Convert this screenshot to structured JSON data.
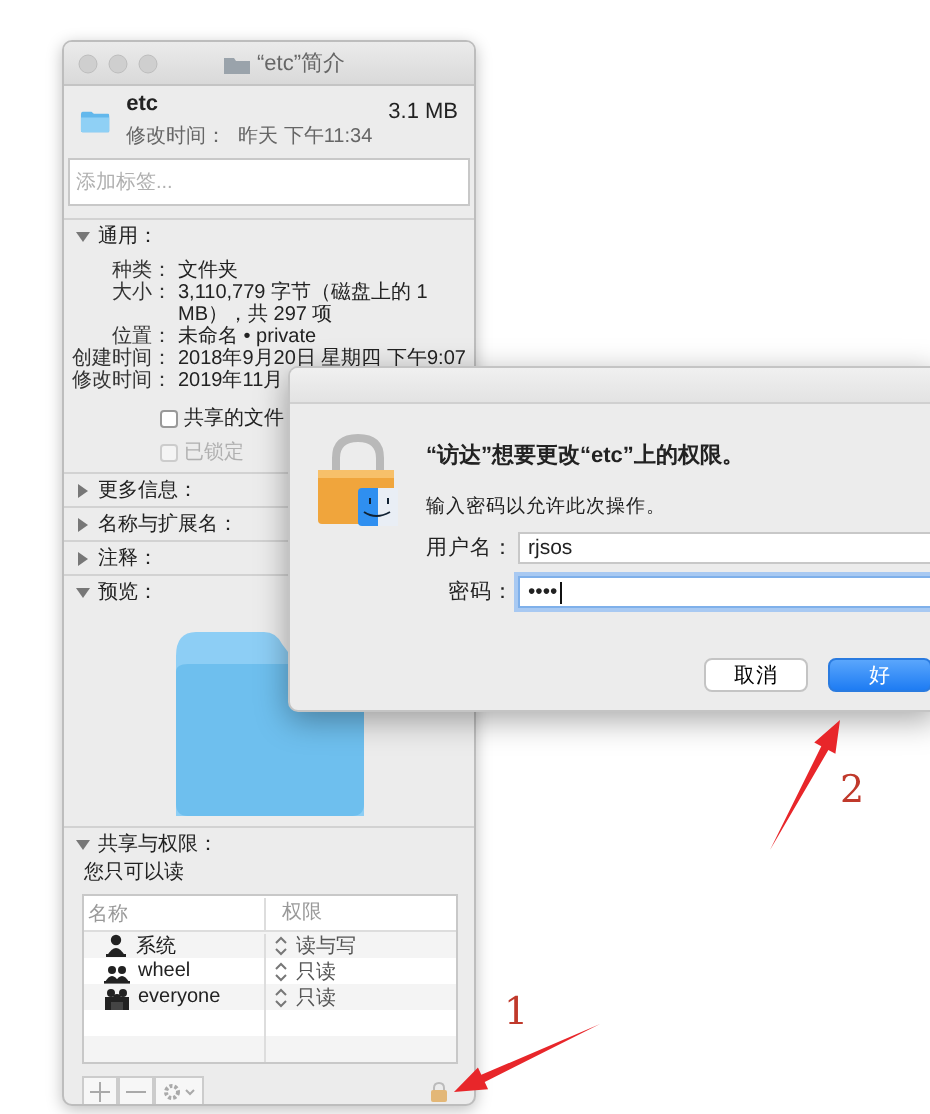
{
  "info_window": {
    "title": "“etc”简介",
    "name": "etc",
    "size": "3.1 MB",
    "modified_label": "修改时间：",
    "modified": "昨天 下午11:34",
    "tags": {
      "placeholder": "添加标签..."
    },
    "general": {
      "label": "通用：",
      "expanded": true,
      "rows": [
        {
          "label": "种类：",
          "value": "文件夹"
        },
        {
          "label": "大小：",
          "value": "3,110,779 字节（磁盘上的 1 MB），共 297 项"
        },
        {
          "label": "位置：",
          "value": "未命名 • private"
        },
        {
          "label": "创建时间：",
          "value": "2018年9月20日 星期四 下午9:07"
        },
        {
          "label": "修改时间：",
          "value": "2019年11月"
        }
      ],
      "options": [
        {
          "label": "共享的文件",
          "checked": false,
          "disabled": false
        },
        {
          "label": "已锁定",
          "checked": false,
          "disabled": true
        }
      ]
    },
    "sections": [
      {
        "label": "更多信息：",
        "expanded": false
      },
      {
        "label": "名称与扩展名：",
        "expanded": false
      },
      {
        "label": "注释：",
        "expanded": false
      },
      {
        "label": "预览：",
        "expanded": true
      }
    ],
    "sharing": {
      "label": "共享与权限：",
      "expanded": true,
      "note": "您只可以读",
      "columns": [
        "名称",
        "权限"
      ],
      "rows": [
        {
          "name": "系统",
          "kind": "user",
          "privilege": "读与写"
        },
        {
          "name": "wheel",
          "kind": "group",
          "privilege": "只读"
        },
        {
          "name": "everyone",
          "kind": "everyone",
          "privilege": "只读"
        }
      ]
    }
  },
  "dialog": {
    "title": "“访达”想要更改“etc”上的权限。",
    "message": "输入密码以允许此次操作。",
    "fields": [
      {
        "label": "用户名：",
        "value": "rjsos",
        "focused": false
      },
      {
        "label": "密码：",
        "value": "••••",
        "focused": true
      }
    ],
    "buttons": [
      {
        "label": "取消",
        "default": false
      },
      {
        "label": "好",
        "default": true
      }
    ]
  },
  "annotations": [
    {
      "label": "1"
    },
    {
      "label": "2"
    }
  ]
}
